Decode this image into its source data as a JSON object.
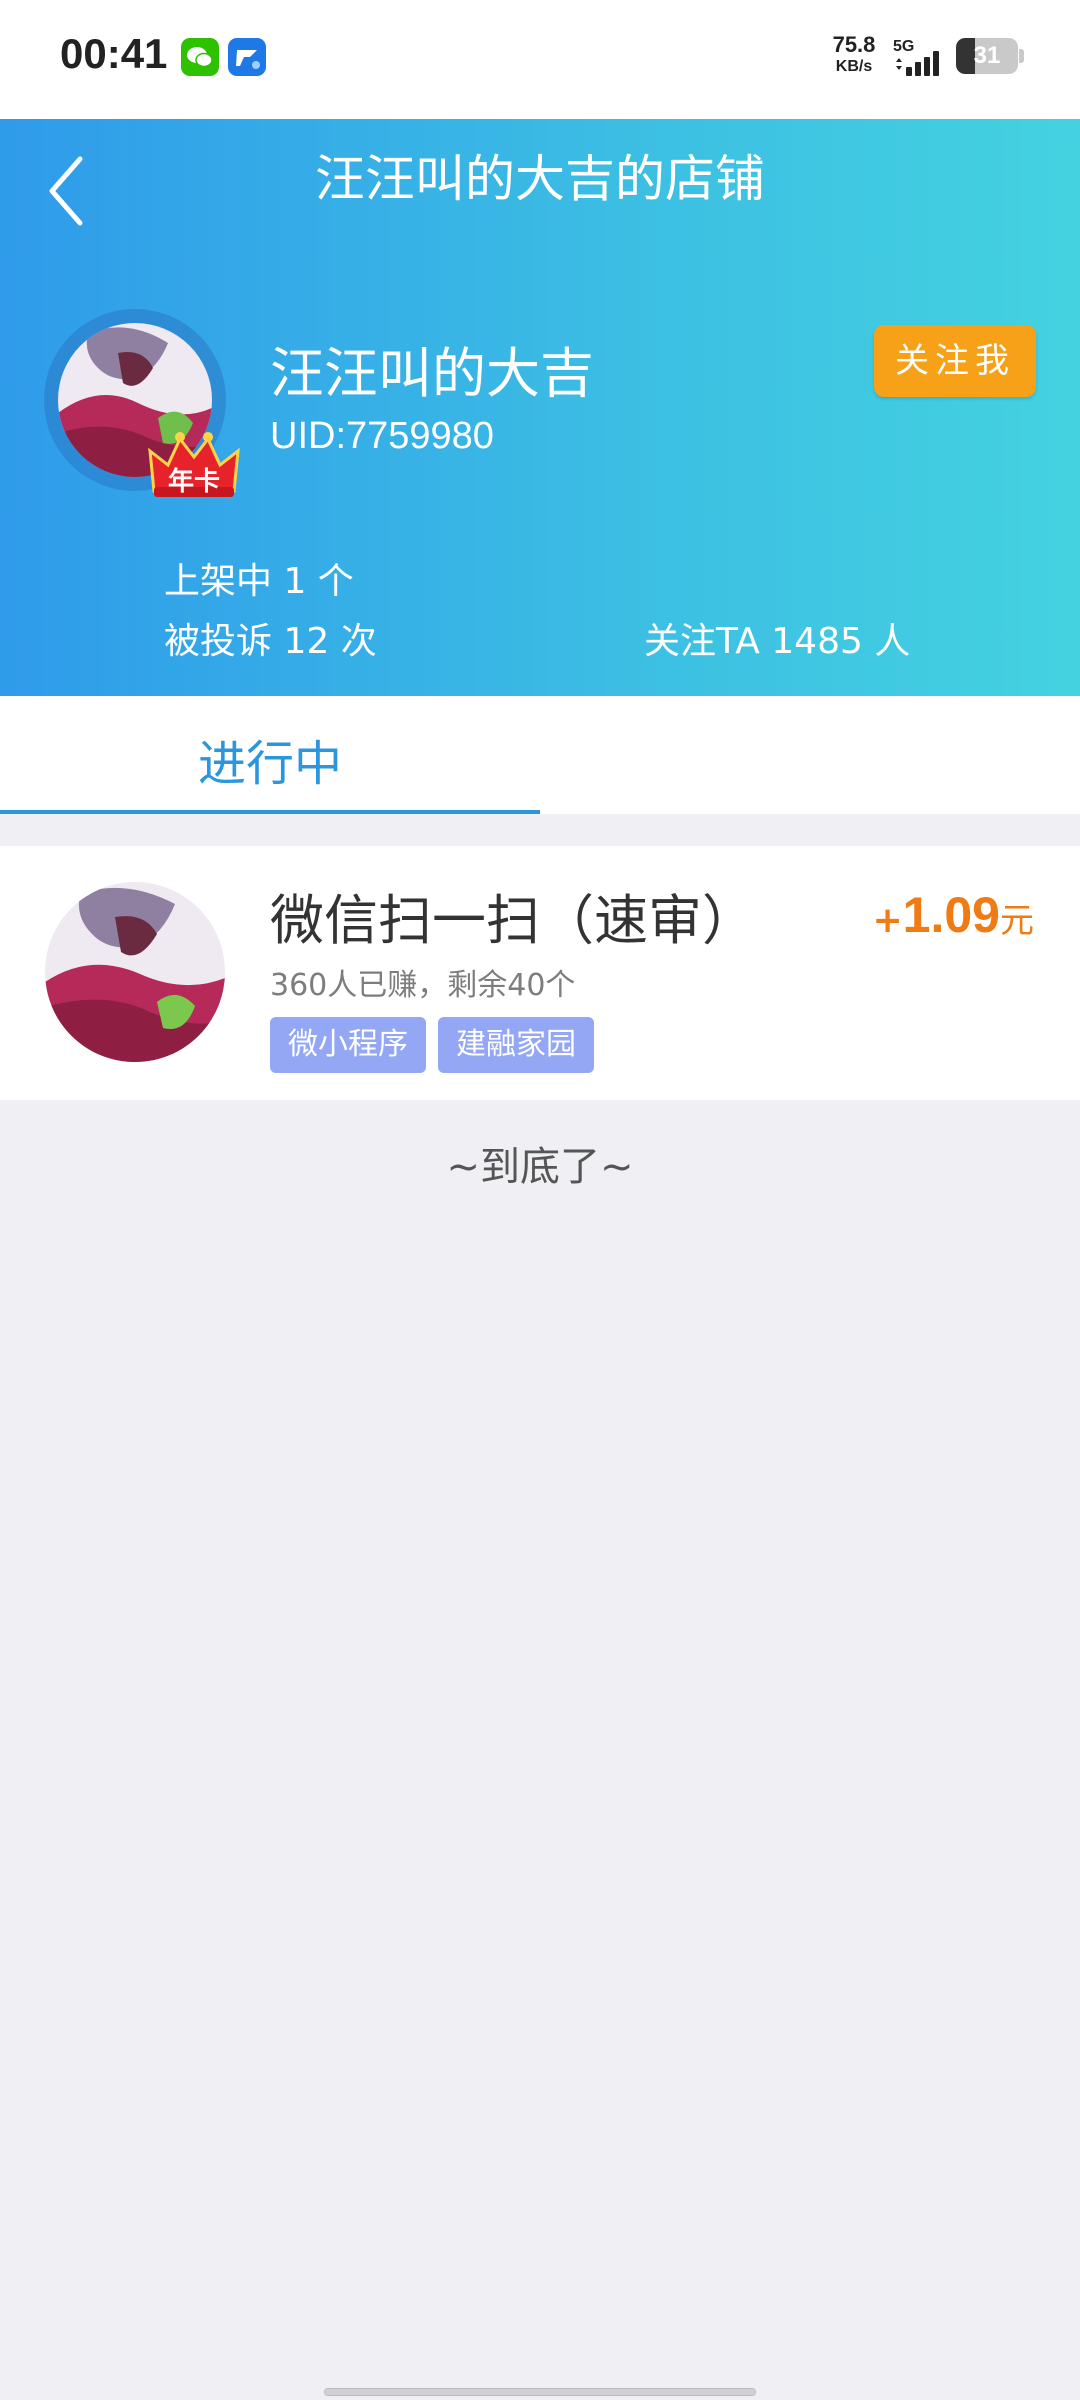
{
  "status_bar": {
    "time": "00:41",
    "net_speed_value": "75.8",
    "net_speed_unit": "KB/s",
    "net_type": "5G",
    "battery": "31",
    "battery_level": 0.31,
    "icons": [
      "wechat-icon",
      "app-icon",
      "signal-icon",
      "battery-icon"
    ]
  },
  "header": {
    "title": "汪汪叫的大吉的店铺",
    "shop_name": "汪汪叫的大吉",
    "uid": "UID:7759980",
    "badge": "年卡",
    "follow_label": "关注我",
    "stats": {
      "listed": "上架中 1 个",
      "complaints": "被投诉 12 次",
      "followers": "关注TA 1485 人"
    },
    "gradient": [
      "#2f9bea",
      "#44d2e0"
    ]
  },
  "tabs": [
    {
      "label": "进行中",
      "active": true
    }
  ],
  "tasks": [
    {
      "title": "微信扫一扫（速审）",
      "meta": "360人已赚，剩余40个",
      "tags": [
        "微小程序",
        "建融家园"
      ],
      "reward_sign": "+",
      "reward_amount": "1.09",
      "reward_unit": "元"
    }
  ],
  "end_text": "~到底了~",
  "colors": {
    "accent": "#2b96de",
    "follow_button": "#f7a118",
    "reward": "#f07a14",
    "tag": "#93a7f5",
    "background": "#efeff4"
  }
}
